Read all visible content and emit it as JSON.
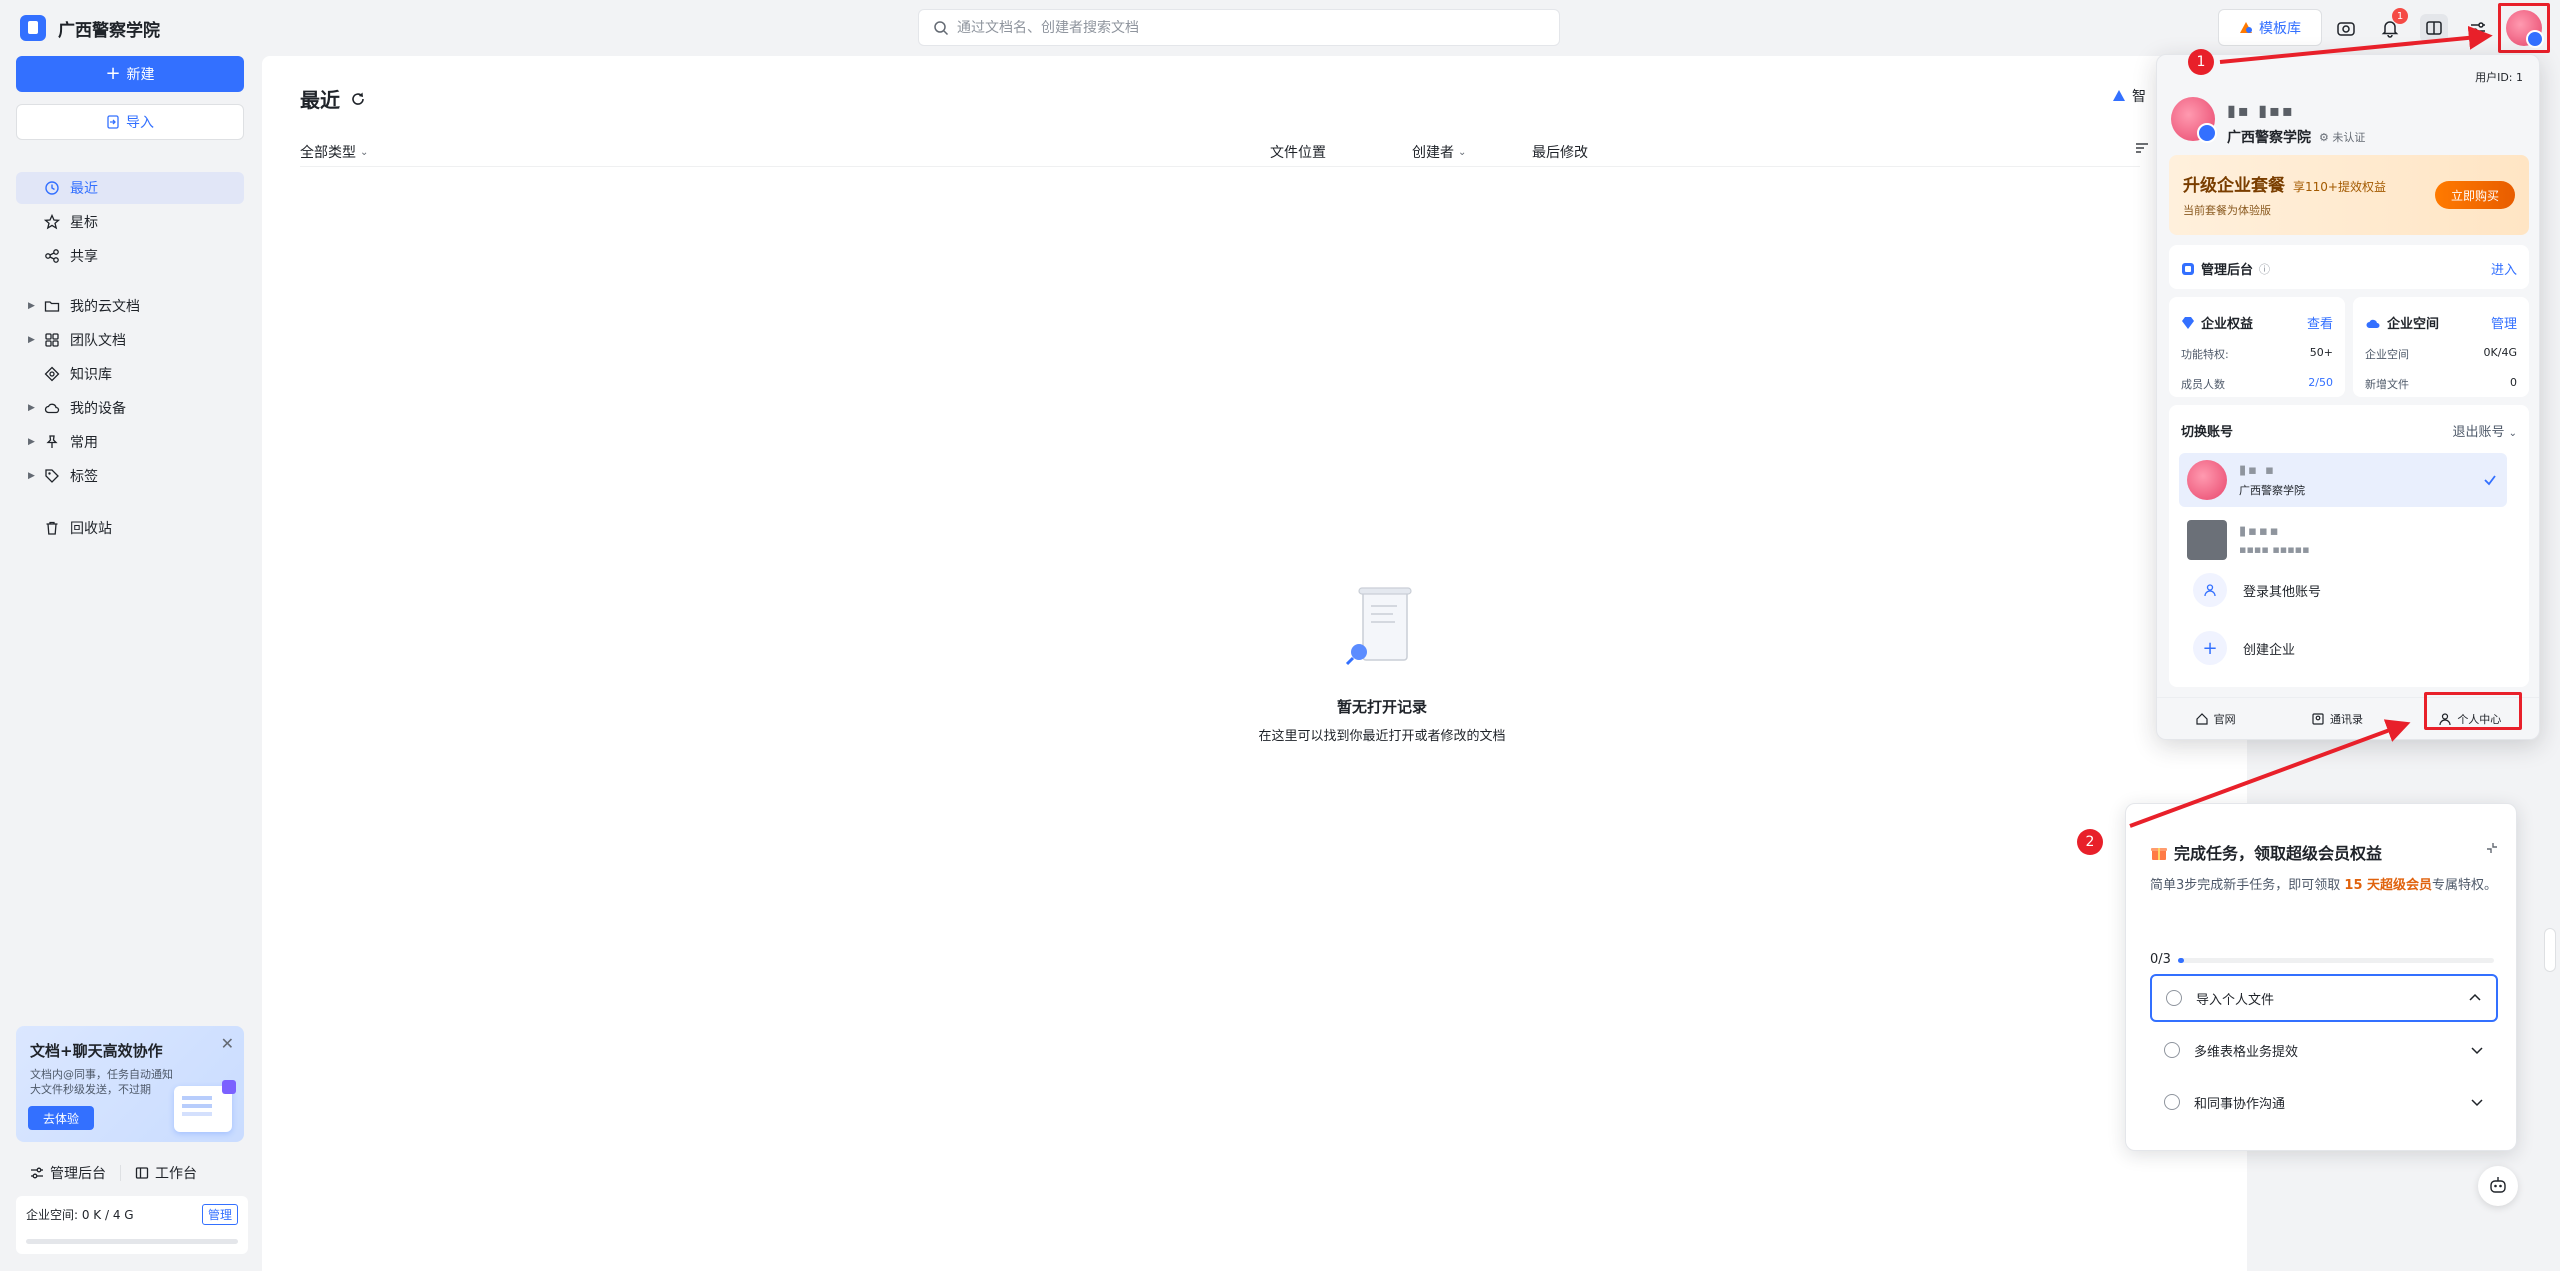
{
  "brand": {
    "name": "广西警察学院"
  },
  "search": {
    "placeholder": "通过文档名、创建者搜索文档"
  },
  "topbar": {
    "template_label": "模板库",
    "notif_count": "1"
  },
  "sidebar": {
    "new_label": "新建",
    "import_label": "导入",
    "items": [
      {
        "label": "最近",
        "icon": "clock-icon"
      },
      {
        "label": "星标",
        "icon": "star-icon"
      },
      {
        "label": "共享",
        "icon": "share-icon"
      },
      {
        "label": "我的云文档",
        "icon": "folder-icon"
      },
      {
        "label": "团队文档",
        "icon": "team-icon"
      },
      {
        "label": "知识库",
        "icon": "knowledge-icon"
      },
      {
        "label": "我的设备",
        "icon": "cloud-icon"
      },
      {
        "label": "常用",
        "icon": "pin-icon"
      },
      {
        "label": "标签",
        "icon": "tag-icon"
      },
      {
        "label": "回收站",
        "icon": "trash-icon"
      }
    ],
    "promo": {
      "title": "文档+聊天高效协作",
      "line1": "文档内@同事，任务自动通知",
      "line2": "大文件秒级发送，不过期",
      "button": "去体验"
    },
    "footer": {
      "admin": "管理后台",
      "workbench": "工作台"
    },
    "storage": {
      "text": "企业空间: 0 K / 4 G",
      "button": "管理"
    }
  },
  "main": {
    "title": "最近",
    "smart_label": "智",
    "columns": {
      "type": "全部类型",
      "location": "文件位置",
      "creator": "创建者",
      "modified": "最后修改"
    },
    "empty": {
      "title": "暂无打开记录",
      "subtitle": "在这里可以找到你最近打开或者修改的文档"
    }
  },
  "account_popup": {
    "user_id": "用户ID: 1",
    "name": "▮▪ ▮▪▪",
    "org": "广西警察学院",
    "cert": "未认证",
    "upgrade": {
      "title": "升级企业套餐",
      "tag": "享110+提效权益",
      "sub": "当前套餐为体验版",
      "button": "立即购买"
    },
    "admin": {
      "title": "管理后台",
      "link": "进入"
    },
    "rights": {
      "title": "企业权益",
      "link": "查看",
      "rows": [
        {
          "k": "功能特权:",
          "v": "50+"
        },
        {
          "k": "成员人数",
          "v": "2/50"
        }
      ]
    },
    "space": {
      "title": "企业空间",
      "link": "管理",
      "rows": [
        {
          "k": "企业空间",
          "v": "0K/4G"
        },
        {
          "k": "新增文件",
          "v": "0"
        }
      ]
    },
    "switch": {
      "title": "切换账号",
      "logout": "退出账号",
      "accounts": [
        {
          "name": "▮▪ ▪",
          "org": "广西警察学院"
        },
        {
          "name": "▮▪▪▪",
          "org": "▪▪▪▪ ▪▪▪▪▪"
        }
      ],
      "login_other": "登录其他账号",
      "create_org": "创建企业"
    },
    "footer": {
      "website": "官网",
      "contacts": "通讯录",
      "personal": "个人中心"
    }
  },
  "task_panel": {
    "title": "完成任务，领取超级会员权益",
    "desc_pre": "简单3步完成新手任务，即可领取 ",
    "desc_hl": "15 天超级会员",
    "desc_post": "专属特权。",
    "progress_label": "0/3",
    "progress": 0.02,
    "items": [
      "导入个人文件",
      "多维表格业务提效",
      "和同事协作沟通"
    ]
  },
  "annotations": {
    "marker1": "1",
    "marker2": "2"
  },
  "colors": {
    "accent": "#3370ff",
    "annotation": "#e8202a",
    "upgrade": "#e85d00"
  }
}
